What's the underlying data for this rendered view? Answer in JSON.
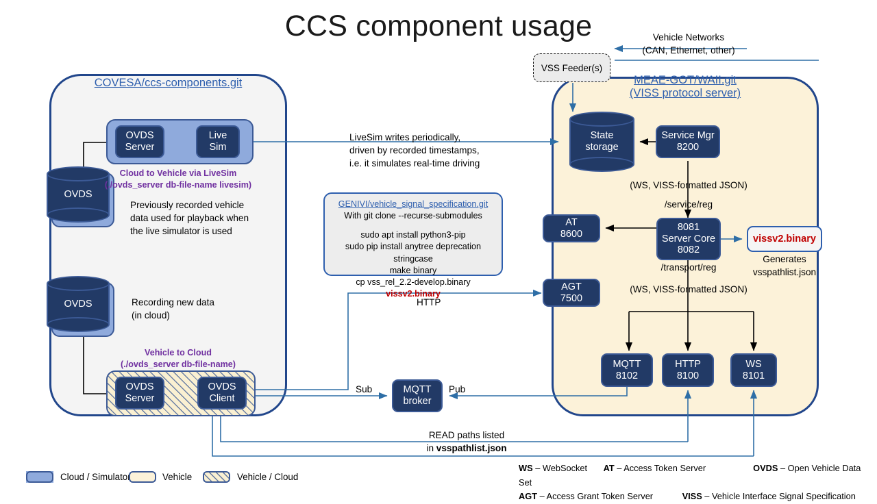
{
  "title": "CCS component usage",
  "left_panel": {
    "repo": "COVESA/ccs-components.git"
  },
  "right_panel": {
    "repo": "MEAE-GOT/WAII.git",
    "subtitle": "(VISS protocol server)"
  },
  "nodes": {
    "ovds_server_top": "OVDS\nServer",
    "live_sim": "Live\nSim",
    "ovds_cyl_top": "OVDS",
    "ovds_cyl_bottom": "OVDS",
    "ovds_server_bottom": "OVDS\nServer",
    "ovds_client": "OVDS\nClient",
    "mqtt_broker": "MQTT\nbroker",
    "vss_feeder": "VSS Feeder(s)",
    "state_storage": "State\nstorage",
    "service_mgr": "Service Mgr\n8200",
    "at": "AT\n8600",
    "agt": "AGT\n7500",
    "server_core": "8081\nServer Core\n8082",
    "mqtt": "MQTT\n8102",
    "http": "HTTP\n8100",
    "ws": "WS\n8101",
    "binary": "vissv2.binary"
  },
  "annotations": {
    "vehicle_networks": "Vehicle Networks\n(CAN, Ethernet, other)",
    "livesim_note": "LiveSim writes periodically,\ndriven by recorded timestamps,\ni.e. it simulates real-time driving",
    "cloud_to_vehicle_title": "Cloud to Vehicle via LiveSim",
    "cloud_to_vehicle_cmd": "(./ovds_server db-file-name livesim)",
    "playback_note": "Previously recorded vehicle\ndata used for playback when\nthe live simulator is used",
    "recording_note": "Recording new data\n(in cloud)",
    "vehicle_to_cloud_title": "Vehicle to Cloud",
    "vehicle_to_cloud_cmd": "(./ovds_server db-file-name)",
    "ws_viss_json_1": "(WS, VISS-formatted JSON)",
    "ws_viss_json_2": "(WS, VISS-formatted JSON)",
    "service_reg": "/service/reg",
    "transport_reg": "/transport/reg",
    "generates": "Generates\nvsspathlist.json",
    "http_label": "HTTP",
    "sub_label": "Sub",
    "pub_label": "Pub",
    "read_paths_line1": "READ paths listed",
    "read_paths_line2_prefix": "in ",
    "read_paths_line2_bold": "vsspathlist.json"
  },
  "genivi_box": {
    "link": "GENIVI/vehicle_signal_specification.git",
    "line1": "With git clone --recurse-submodules",
    "line2": "sudo apt install python3-pip",
    "line3": "sudo pip install anytree deprecation stringcase",
    "line4": "make binary",
    "line5_prefix": "cp vss_rel_2.2-develop.binary ",
    "line5_red": "vissv2.binary"
  },
  "legend": {
    "items": [
      {
        "label": "Cloud / Simulator",
        "style": "solid-blue"
      },
      {
        "label": "Vehicle",
        "style": "cream"
      },
      {
        "label": "Vehicle / Cloud",
        "style": "hatched"
      }
    ]
  },
  "abbreviations": [
    {
      "key": "WS",
      "desc": "– WebSocket"
    },
    {
      "key": "AT",
      "desc": "– Access Token Server"
    },
    {
      "key": "OVDS",
      "desc": "– Open Vehicle Data Set"
    },
    {
      "key": "AGT",
      "desc": "– Access Grant Token Server"
    },
    {
      "key": "VISS",
      "desc": "– Vehicle Interface Signal Specification"
    }
  ],
  "colors": {
    "panel_border": "#21468B",
    "node_fill": "#223A66",
    "group_blue": "#8FAADC",
    "vehicle_cream": "#FCF2D9",
    "link_blue": "#2E5FAE",
    "purple": "#7030A0",
    "red": "#C00000"
  }
}
